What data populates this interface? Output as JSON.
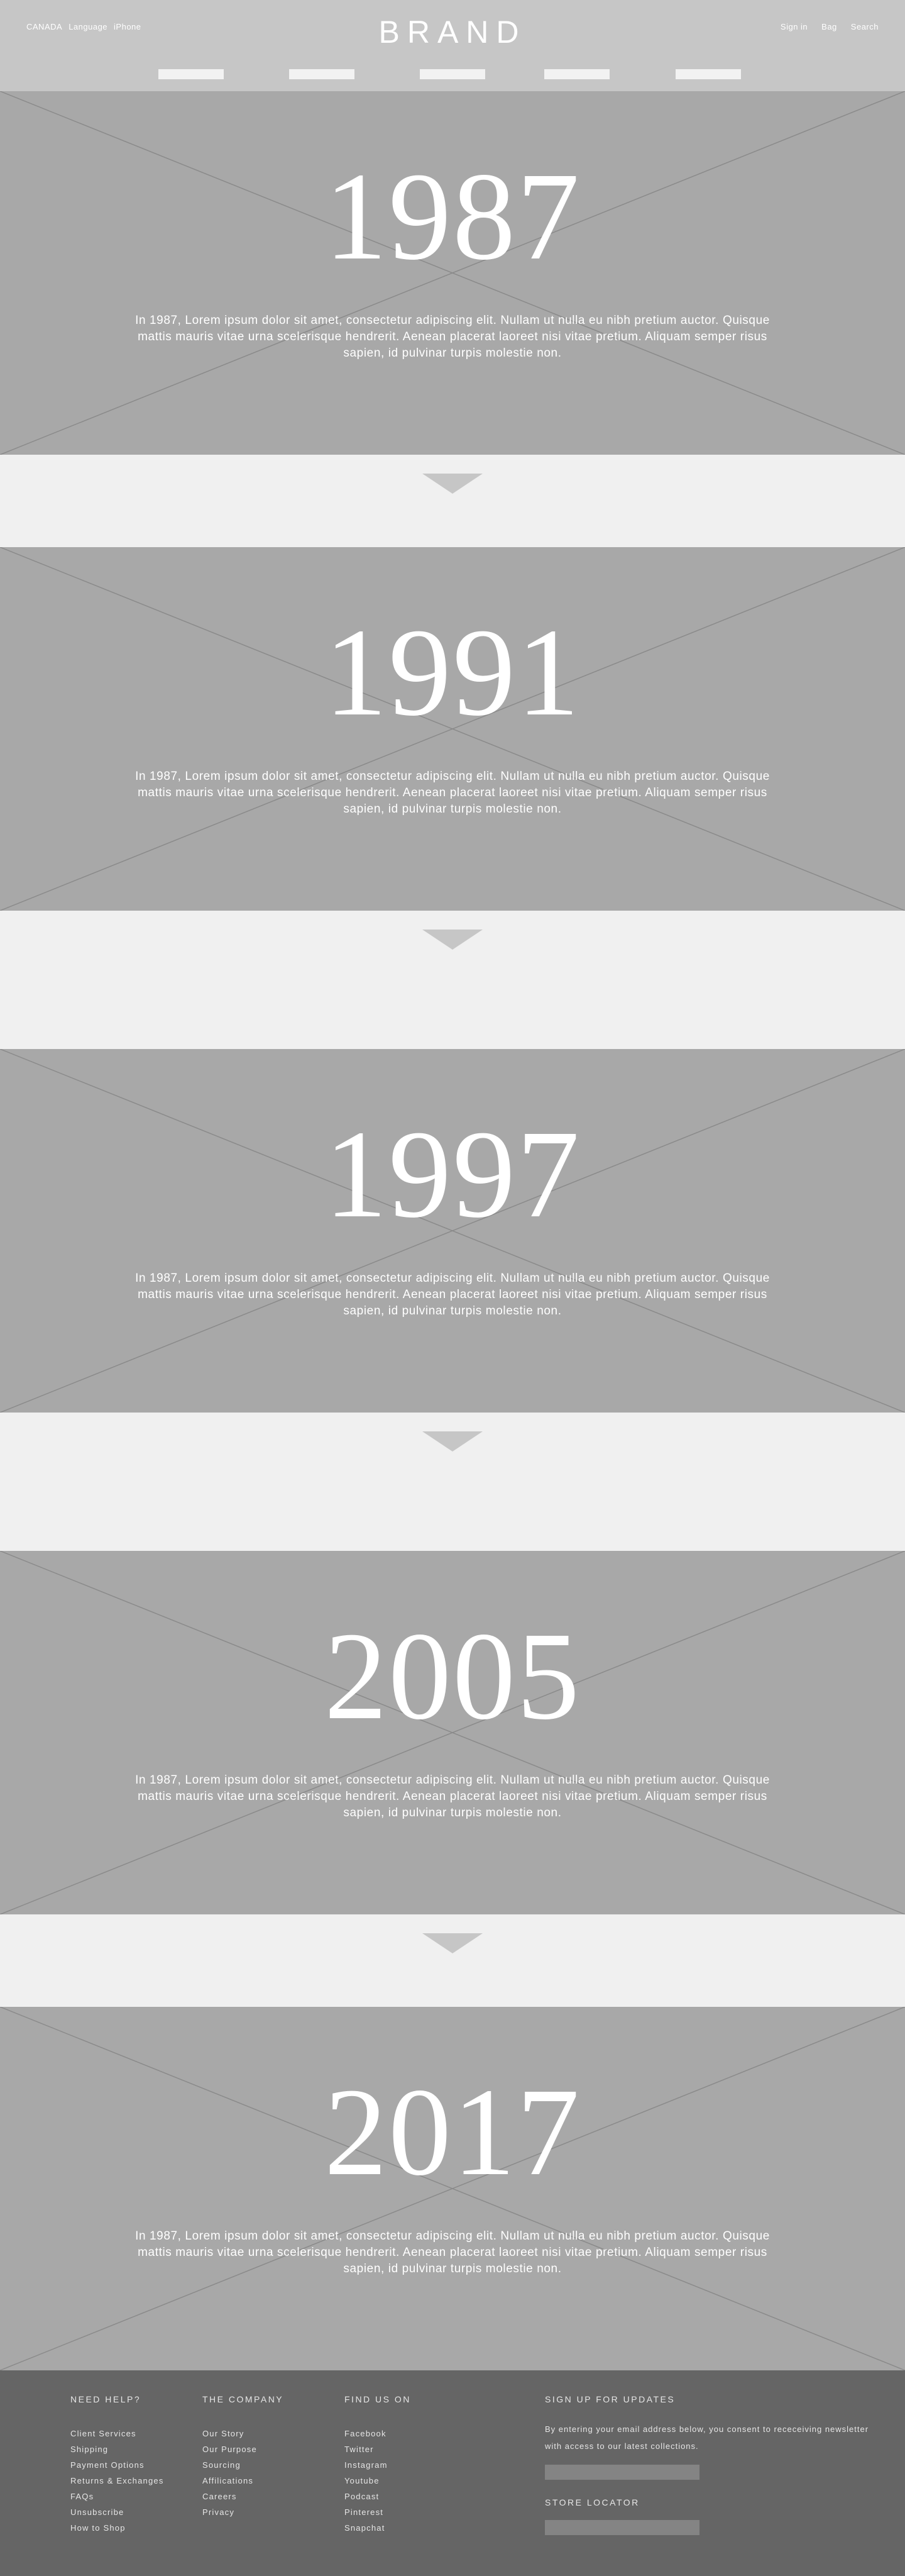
{
  "header": {
    "util_left": [
      "CANADA",
      "Language",
      "iPhone"
    ],
    "brand": "BRAND",
    "util_right": [
      "Sign in",
      "Bag",
      "Search"
    ]
  },
  "timeline": [
    {
      "year": "1987",
      "text": "In 1987, Lorem ipsum dolor sit amet, consectetur adipiscing elit. Nullam ut nulla eu nibh pretium auctor. Quisque mattis mauris vitae urna scelerisque hendrerit. Aenean placerat laoreet nisi vitae pretium. Aliquam semper risus sapien, id pulvinar turpis molestie non."
    },
    {
      "year": "1991",
      "text": "In 1987, Lorem ipsum dolor sit amet, consectetur adipiscing elit. Nullam ut nulla eu nibh pretium auctor. Quisque mattis mauris vitae urna scelerisque hendrerit. Aenean placerat laoreet nisi vitae pretium. Aliquam semper risus sapien, id pulvinar turpis molestie non."
    },
    {
      "year": "1997",
      "text": "In 1987, Lorem ipsum dolor sit amet, consectetur adipiscing elit. Nullam ut nulla eu nibh pretium auctor. Quisque mattis mauris vitae urna scelerisque hendrerit. Aenean placerat laoreet nisi vitae pretium. Aliquam semper risus sapien, id pulvinar turpis molestie non."
    },
    {
      "year": "2005",
      "text": "In 1987, Lorem ipsum dolor sit amet, consectetur adipiscing elit. Nullam ut nulla eu nibh pretium auctor. Quisque mattis mauris vitae urna scelerisque hendrerit. Aenean placerat laoreet nisi vitae pretium. Aliquam semper risus sapien, id pulvinar turpis molestie non."
    },
    {
      "year": "2017",
      "text": "In 1987, Lorem ipsum dolor sit amet, consectetur adipiscing elit. Nullam ut nulla eu nibh pretium auctor. Quisque mattis mauris vitae urna scelerisque hendrerit. Aenean placerat laoreet nisi vitae pretium. Aliquam semper risus sapien, id pulvinar turpis molestie non."
    }
  ],
  "footer": {
    "need_help": {
      "heading": "NEED HELP?",
      "links": [
        "Client Services",
        "Shipping",
        "Payment Options",
        "Returns & Exchanges",
        "FAQs",
        "Unsubscribe",
        "How to Shop"
      ]
    },
    "company": {
      "heading": "THE COMPANY",
      "links": [
        "Our Story",
        "Our Purpose",
        "Sourcing",
        "Affilications",
        "Careers",
        "Privacy"
      ]
    },
    "find_us": {
      "heading": "FIND US ON",
      "links": [
        "Facebook",
        "Twitter",
        "Instagram",
        "Youtube",
        "Podcast",
        "Pinterest",
        "Snapchat"
      ]
    },
    "signup": {
      "heading": "SIGN UP FOR UPDATES",
      "text": "By entering your email address below, you consent to receceiving newsletter with access to our latest collections."
    },
    "store_locator": {
      "heading": "STORE LOCATOR"
    }
  },
  "colors": {
    "header_bg": "#c6c6c6",
    "hero_bg": "#a8a8a8",
    "page_bg": "#f0f0f0",
    "footer_bg": "#656565"
  }
}
